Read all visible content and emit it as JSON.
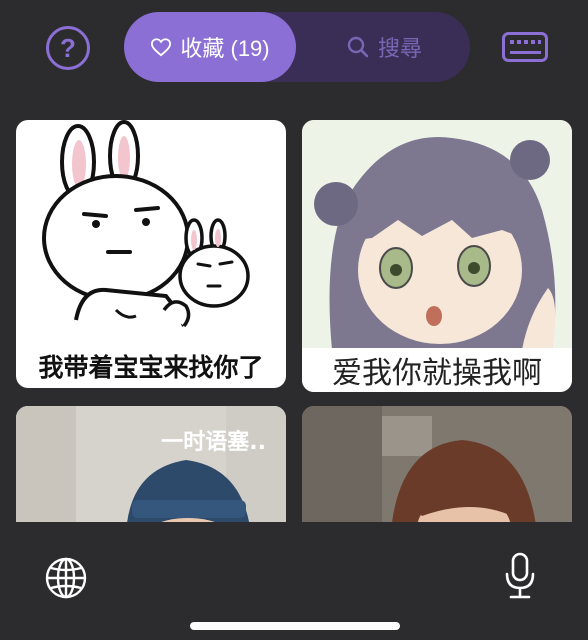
{
  "header": {
    "help_icon": "help-circle-icon",
    "help_glyph": "?",
    "tabs": [
      {
        "label": "收藏 (19)",
        "icon": "heart-icon",
        "selected": true
      },
      {
        "label": "搜尋",
        "icon": "search-icon",
        "selected": false
      }
    ],
    "keyboard_icon": "keyboard-icon"
  },
  "stickers": [
    {
      "caption": "我带着宝宝来找你了"
    },
    {
      "caption": "爱我你就操我啊"
    },
    {
      "caption": "一时语塞.."
    },
    {
      "caption": ""
    }
  ],
  "footer": {
    "globe_icon": "globe-icon",
    "mic_icon": "microphone-icon"
  },
  "colors": {
    "background": "#2c2c2e",
    "accent": "#8b6fd4",
    "segment_bg": "#3a2e57",
    "inactive": "#7a66b3"
  }
}
